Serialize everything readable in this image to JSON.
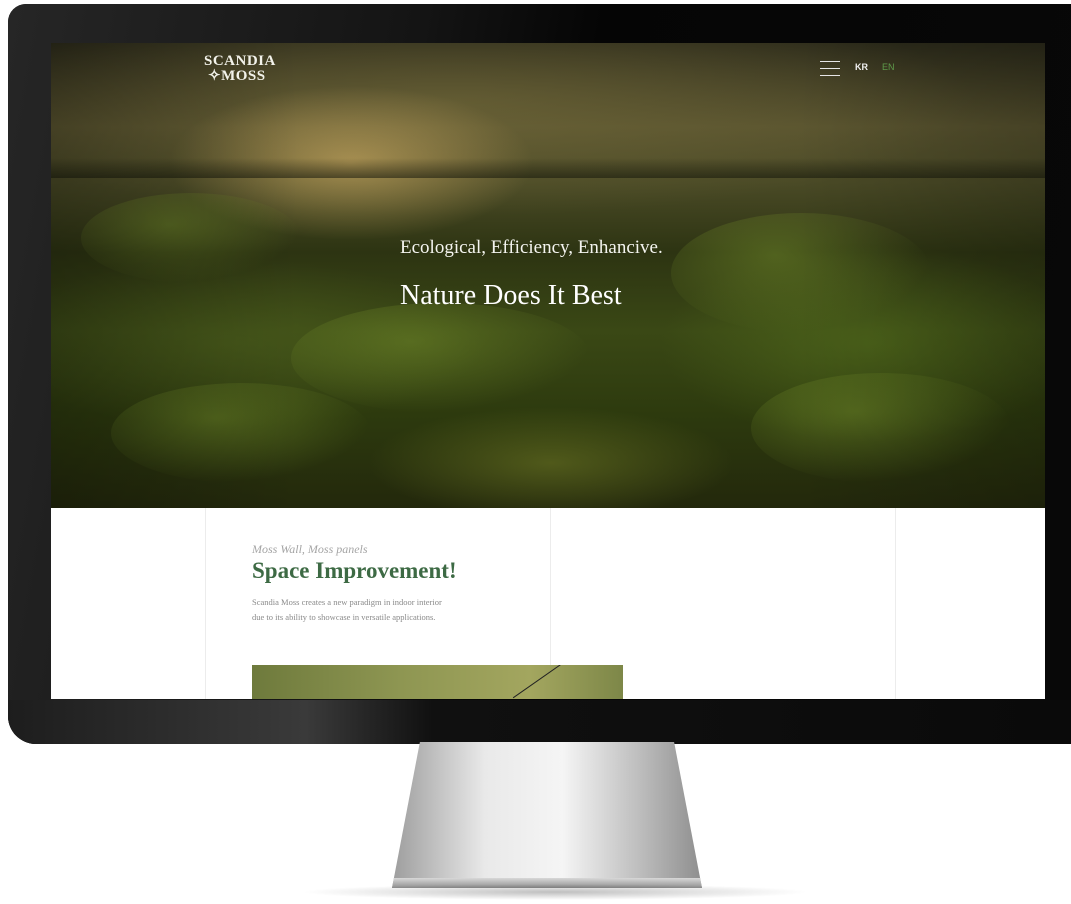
{
  "header": {
    "logo_line1": "SCANDIA",
    "logo_line2": "MOSS",
    "lang_kr": "KR",
    "lang_en": "EN",
    "menu_icon": "hamburger-icon"
  },
  "hero": {
    "tagline": "Ecological, Efficiency, Enhancive.",
    "headline": "Nature Does It Best"
  },
  "section": {
    "subtitle": "Moss Wall, Moss panels",
    "title": "Space Improvement!",
    "description_line1": "Scandia Moss creates a new paradigm in indoor interior",
    "description_line2": "due to its ability to showcase in versatile applications."
  },
  "colors": {
    "accent_green": "#3d6a44",
    "lang_active": "#5e9a4a"
  }
}
